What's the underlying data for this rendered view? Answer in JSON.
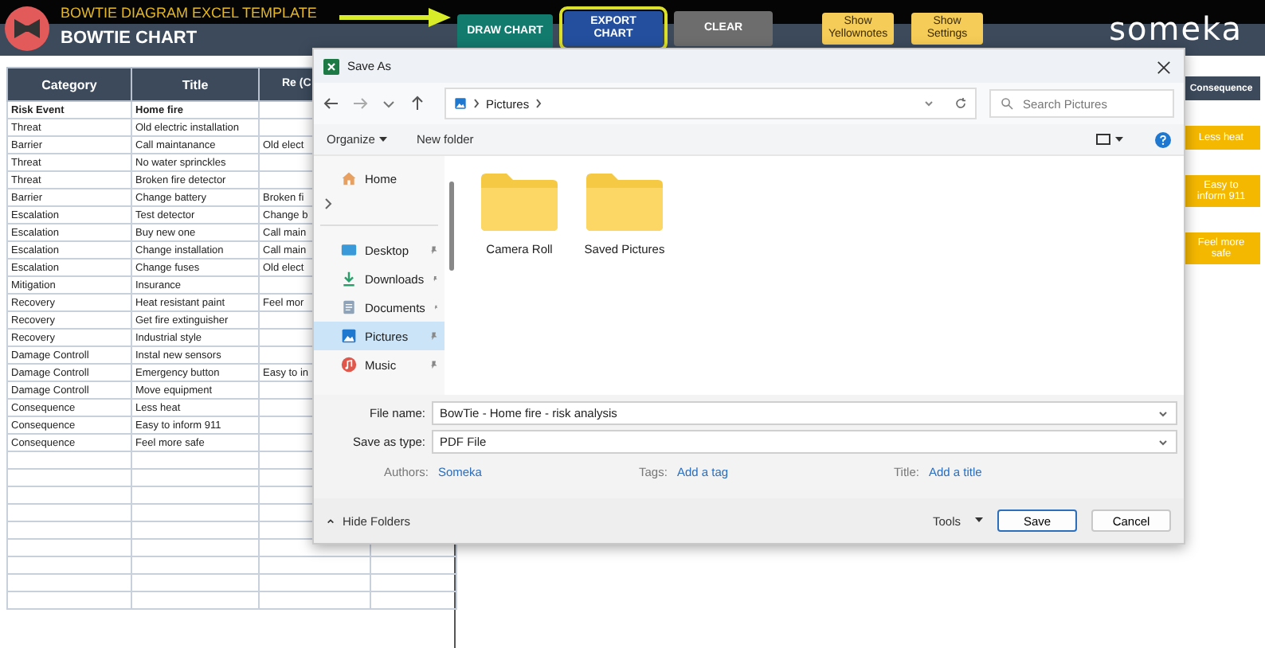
{
  "header": {
    "template_title": "BOWTIE DIAGRAM EXCEL TEMPLATE",
    "chart_title": "BOWTIE CHART",
    "logo": "someka",
    "buttons": [
      {
        "label": "DRAW CHART",
        "kind": "teal",
        "highlighted": false
      },
      {
        "label": "EXPORT CHART",
        "kind": "blue",
        "highlighted": true
      },
      {
        "label": "CLEAR",
        "kind": "grey",
        "highlighted": false
      },
      {
        "label": "Show Yellownotes",
        "kind": "yellow",
        "highlighted": false
      },
      {
        "label": "Show Settings",
        "kind": "yellow",
        "highlighted": false
      }
    ]
  },
  "table": {
    "columns": [
      "Category",
      "Title",
      "Re (C"
    ],
    "rows": [
      {
        "kind": "event",
        "category": "Risk Event",
        "title": "Home fire"
      },
      {
        "kind": "entry",
        "category": "Threat",
        "title": "Old electric installation"
      },
      {
        "kind": "entry",
        "category": "Barrier",
        "title": "Call maintanance",
        "related": "Old elect"
      },
      {
        "kind": "entry",
        "category": "Threat",
        "title": "No water sprinckles"
      },
      {
        "kind": "entry",
        "category": "Threat",
        "title": "Broken fire detector"
      },
      {
        "kind": "entry",
        "category": "Barrier",
        "title": "Change battery",
        "related": "Broken fi"
      },
      {
        "kind": "entry",
        "category": "Escalation",
        "title": "Test detector",
        "related": "Change b"
      },
      {
        "kind": "entry",
        "category": "Escalation",
        "title": "Buy new one",
        "related": "Call main"
      },
      {
        "kind": "entry",
        "category": "Escalation",
        "title": "Change installation",
        "related": "Call main"
      },
      {
        "kind": "entry",
        "category": "Escalation",
        "title": "Change fuses",
        "related": "Old elect"
      },
      {
        "kind": "entry",
        "category": "Mitigation",
        "title": "Insurance"
      },
      {
        "kind": "entry",
        "category": "Recovery",
        "title": "Heat resistant paint",
        "related": "Feel mor"
      },
      {
        "kind": "entry",
        "category": "Recovery",
        "title": "Get fire extinguisher"
      },
      {
        "kind": "entry",
        "category": "Recovery",
        "title": "Industrial style"
      },
      {
        "kind": "entry",
        "category": "Damage Controll",
        "title": "Instal new sensors"
      },
      {
        "kind": "entry",
        "category": "Damage Controll",
        "title": "Emergency button",
        "related": "Easy to in"
      },
      {
        "kind": "entry",
        "category": "Damage Controll",
        "title": "Move equipment"
      },
      {
        "kind": "entry",
        "category": "Consequence",
        "title": "Less heat"
      },
      {
        "kind": "entry",
        "category": "Consequence",
        "title": "Easy to inform 911"
      },
      {
        "kind": "entry",
        "category": "Consequence",
        "title": "Feel more safe"
      }
    ]
  },
  "consequence_panel": {
    "heading": "Consequence",
    "boxes": [
      "Less heat",
      "Easy to inform 911",
      "Feel more safe"
    ]
  },
  "dialog": {
    "title": "Save As",
    "address": "Pictures",
    "search_placeholder": "Search Pictures",
    "organize": "Organize",
    "new_folder": "New folder",
    "nav": [
      {
        "label": "Home",
        "kind": "home",
        "pinned": false,
        "selected": false
      },
      {
        "label": "Desktop",
        "kind": "desktop",
        "pinned": true,
        "selected": false
      },
      {
        "label": "Downloads",
        "kind": "downloads",
        "pinned": true,
        "selected": false
      },
      {
        "label": "Documents",
        "kind": "documents",
        "pinned": true,
        "selected": false
      },
      {
        "label": "Pictures",
        "kind": "pictures",
        "pinned": true,
        "selected": true
      },
      {
        "label": "Music",
        "kind": "music",
        "pinned": true,
        "selected": false
      }
    ],
    "folders": [
      "Camera Roll",
      "Saved Pictures"
    ],
    "fields": [
      {
        "label": "File name:",
        "value": "BowTie - Home fire - risk analysis"
      },
      {
        "label": "Save as type:",
        "value": "PDF File"
      }
    ],
    "properties": [
      {
        "label": "Authors:",
        "value": "Someka"
      },
      {
        "label": "Tags:",
        "value": "Add a tag"
      },
      {
        "label": "Title:",
        "value": "Add a title"
      }
    ],
    "hide_folders": "Hide Folders",
    "tools": "Tools",
    "buttons": [
      {
        "label": "Save",
        "default": true
      },
      {
        "label": "Cancel",
        "default": false
      }
    ]
  }
}
